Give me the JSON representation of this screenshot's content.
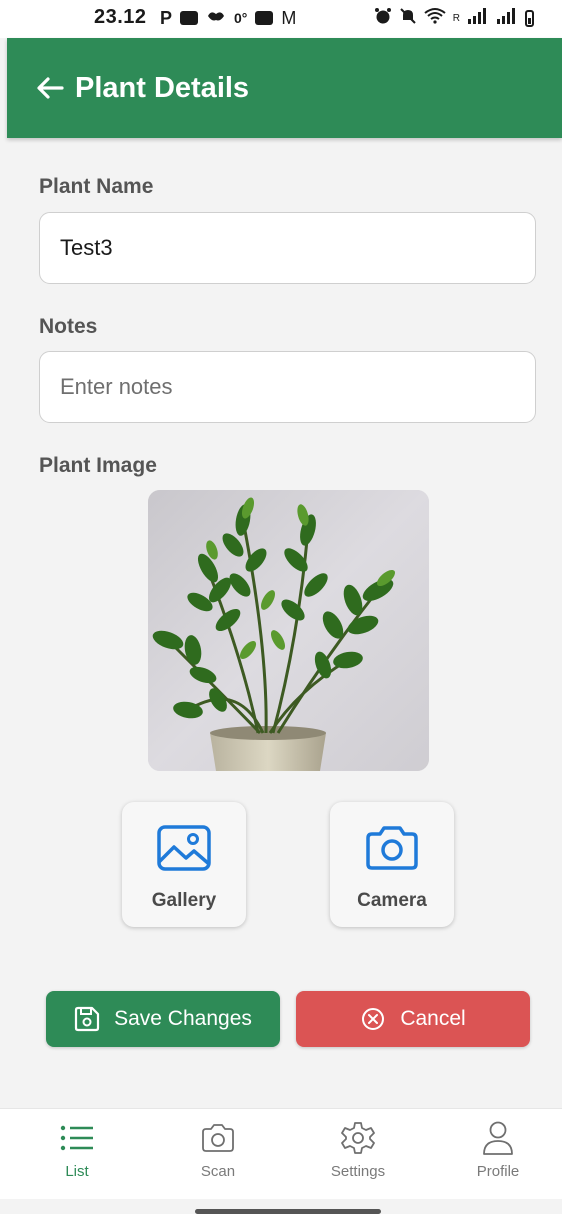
{
  "status_bar": {
    "time": "23.12",
    "left_icons": [
      "p-icon",
      "youtube-icon",
      "bird-icon",
      "temperature-icon",
      "linkedin-icon",
      "gmail-icon"
    ],
    "left_text": [
      "P",
      "0°",
      "M"
    ],
    "right_icons": [
      "alarm-icon",
      "mute-icon",
      "wifi-icon",
      "signal-icon",
      "signal-icon",
      "battery-icon"
    ],
    "roaming_mark": "R"
  },
  "app_bar": {
    "title": "Plant Details",
    "color": "#2e8b57"
  },
  "form": {
    "plant_name_label": "Plant Name",
    "plant_name_value": "Test3",
    "notes_label": "Notes",
    "notes_value": "",
    "notes_placeholder": "Enter notes",
    "plant_image_label": "Plant Image"
  },
  "image_source": {
    "gallery_label": "Gallery",
    "camera_label": "Camera",
    "icon_color": "#1f7ad9"
  },
  "actions": {
    "save_label": "Save Changes",
    "cancel_label": "Cancel",
    "save_color": "#2e8b57",
    "cancel_color": "#db5454"
  },
  "bottom_nav": {
    "items": [
      {
        "label": "List",
        "icon": "list-icon",
        "active": true
      },
      {
        "label": "Scan",
        "icon": "camera-icon",
        "active": false
      },
      {
        "label": "Settings",
        "icon": "gear-icon",
        "active": false
      },
      {
        "label": "Profile",
        "icon": "person-icon",
        "active": false
      }
    ],
    "active_color": "#2e8b57"
  }
}
